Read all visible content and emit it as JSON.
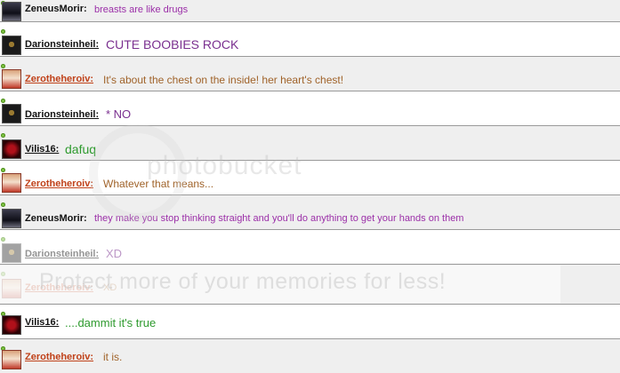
{
  "messages": [
    {
      "user": "ZeneusMorir:",
      "text": "breasts are like drugs"
    },
    {
      "user": "Darionsteinheil:",
      "text": "CUTE BOOBIES ROCK"
    },
    {
      "user": "Zerotheheroiv:",
      "text": "It's about the chest on the inside! her heart's chest!"
    },
    {
      "user": "Darionsteinheil:",
      "text": "* NO"
    },
    {
      "user": "Vilis16:",
      "text": "dafuq"
    },
    {
      "user": "Zerotheheroiv:",
      "text": "Whatever that means..."
    },
    {
      "user": "ZeneusMorir:",
      "text": "they make you stop thinking straight and you'll do anything to get your hands on them"
    },
    {
      "user": "Darionsteinheil:",
      "text": "XD"
    },
    {
      "user": "Zerotheheroiv:",
      "text": "XD"
    },
    {
      "user": "Vilis16:",
      "text": "....dammit it's true"
    },
    {
      "user": "Zerotheheroiv:",
      "text": "it is."
    }
  ],
  "colors": {
    "zeneus_text": "#9b2fa8",
    "darion_text": "#7a2f8f",
    "zero_text": "#a0632a",
    "vilis_text": "#2e9a2e",
    "zero_name": "#c0421a",
    "online_dot": "#7dc242"
  },
  "watermark": {
    "main": "photobucket",
    "banner": "Protect more of your memories for less!"
  }
}
